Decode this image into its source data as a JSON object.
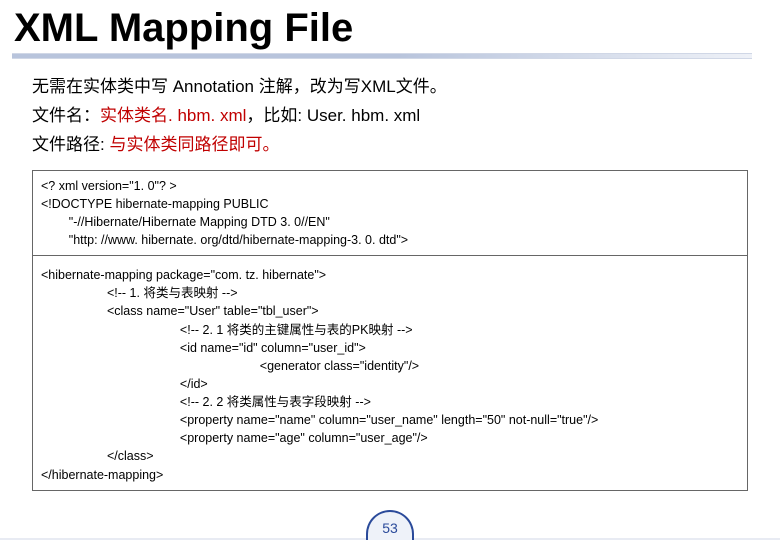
{
  "title": "XML Mapping File",
  "desc": {
    "line1_a": "无需在实体类中写 Annotation 注解，改为写XML文件。",
    "line2_a": "文件名：",
    "line2_b": "实体类名. hbm. xml",
    "line2_c": "，比如: User. hbm. xml",
    "line3_a": "文件路径:  ",
    "line3_b": "与实体类同路径即可。"
  },
  "code": {
    "seg1": {
      "l1": "<? xml version=\"1. 0\"? >",
      "l2": "<!DOCTYPE hibernate-mapping PUBLIC",
      "l3": "        \"-//Hibernate/Hibernate Mapping DTD 3. 0//EN\"",
      "l4": "        \"http: //www. hibernate. org/dtd/hibernate-mapping-3. 0. dtd\">"
    },
    "seg2": {
      "l1": "<hibernate-mapping package=\"com. tz. hibernate\">",
      "l2": "                   <!-- 1. 将类与表映射 -->",
      "l3": "                   <class name=\"User\" table=\"tbl_user\">",
      "l4": "                                        <!-- 2. 1 将类的主键属性与表的PK映射 -->",
      "l5": "                                        <id name=\"id\" column=\"user_id\">",
      "l6": "                                                               <generator class=\"identity\"/>",
      "l7": "                                        </id>",
      "l8": "                                        <!-- 2. 2 将类属性与表字段映射 -->",
      "l9": "                                        <property name=\"name\" column=\"user_name\" length=\"50\" not-null=\"true\"/>",
      "l10": "                                        <property name=\"age\" column=\"user_age\"/>",
      "l11": "                   </class>",
      "l12": "</hibernate-mapping>"
    }
  },
  "pageNumber": "53"
}
